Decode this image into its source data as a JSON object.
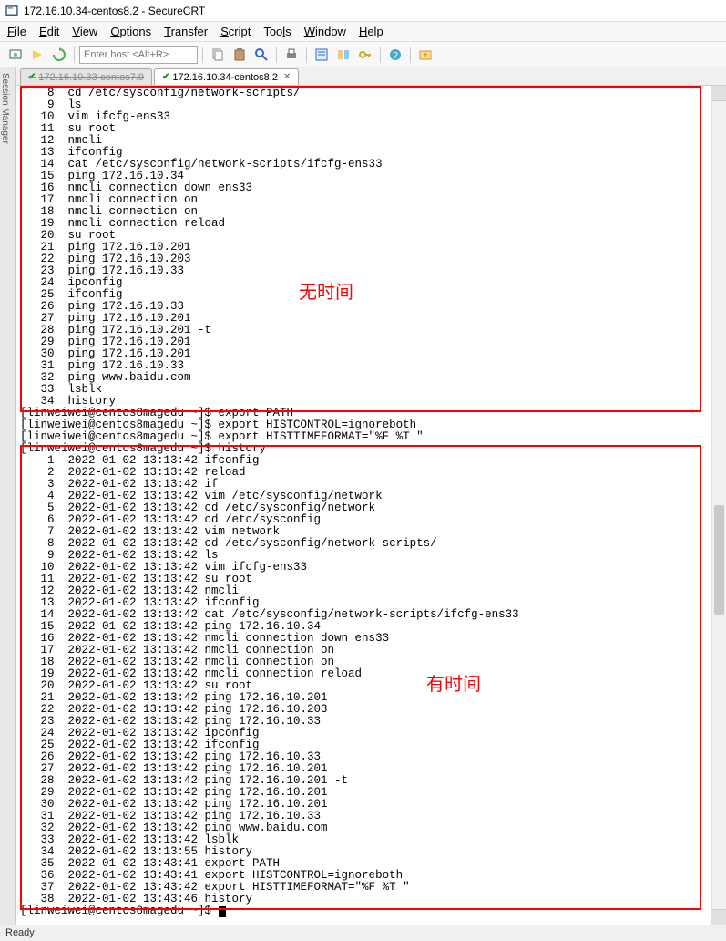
{
  "window": {
    "title": "172.16.10.34-centos8.2 - SecureCRT"
  },
  "menu": {
    "file": "File",
    "edit": "Edit",
    "view": "View",
    "options": "Options",
    "transfer": "Transfer",
    "script": "Script",
    "tools": "Tools",
    "window": "Window",
    "help": "Help"
  },
  "toolbar": {
    "host_placeholder": "Enter host <Alt+R>"
  },
  "session_manager_label": "Session Manager",
  "tabs": [
    {
      "label": "172.16.10.33-centos7.9",
      "active": false
    },
    {
      "label": "172.16.10.34-centos8.2",
      "active": true
    }
  ],
  "annotations": {
    "no_time": "无时间",
    "has_time": "有时间"
  },
  "history_top": [
    {
      "n": "8",
      "cmd": "cd /etc/sysconfig/network-scripts/"
    },
    {
      "n": "9",
      "cmd": "ls"
    },
    {
      "n": "10",
      "cmd": "vim ifcfg-ens33"
    },
    {
      "n": "11",
      "cmd": "su root"
    },
    {
      "n": "12",
      "cmd": "nmcli"
    },
    {
      "n": "13",
      "cmd": "ifconfig"
    },
    {
      "n": "14",
      "cmd": "cat /etc/sysconfig/network-scripts/ifcfg-ens33"
    },
    {
      "n": "15",
      "cmd": "ping 172.16.10.34"
    },
    {
      "n": "16",
      "cmd": "nmcli connection down ens33"
    },
    {
      "n": "17",
      "cmd": "nmcli connection on"
    },
    {
      "n": "18",
      "cmd": "nmcli connection on"
    },
    {
      "n": "19",
      "cmd": "nmcli connection reload"
    },
    {
      "n": "20",
      "cmd": "su root"
    },
    {
      "n": "21",
      "cmd": "ping 172.16.10.201"
    },
    {
      "n": "22",
      "cmd": "ping 172.16.10.203"
    },
    {
      "n": "23",
      "cmd": "ping 172.16.10.33"
    },
    {
      "n": "24",
      "cmd": "ipconfig"
    },
    {
      "n": "25",
      "cmd": "ifconfig"
    },
    {
      "n": "26",
      "cmd": "ping 172.16.10.33"
    },
    {
      "n": "27",
      "cmd": "ping 172.16.10.201"
    },
    {
      "n": "28",
      "cmd": "ping 172.16.10.201 -t"
    },
    {
      "n": "29",
      "cmd": "ping 172.16.10.201"
    },
    {
      "n": "30",
      "cmd": "ping 172.16.10.201"
    },
    {
      "n": "31",
      "cmd": "ping 172.16.10.33"
    },
    {
      "n": "32",
      "cmd": "ping www.baidu.com"
    },
    {
      "n": "33",
      "cmd": "lsblk"
    },
    {
      "n": "34",
      "cmd": "history"
    }
  ],
  "mid_lines": [
    "[linweiwei@centos8magedu ~]$ export PATH",
    "[linweiwei@centos8magedu ~]$ export HISTCONTROL=ignoreboth",
    "[linweiwei@centos8magedu ~]$ export HISTTIMEFORMAT=\"%F %T \"",
    "[linweiwei@centos8magedu ~]$ history"
  ],
  "history_bottom": [
    {
      "n": "1",
      "ts": "2022-01-02 13:13:42",
      "cmd": "ifconfig"
    },
    {
      "n": "2",
      "ts": "2022-01-02 13:13:42",
      "cmd": "reload"
    },
    {
      "n": "3",
      "ts": "2022-01-02 13:13:42",
      "cmd": "if"
    },
    {
      "n": "4",
      "ts": "2022-01-02 13:13:42",
      "cmd": "vim /etc/sysconfig/network"
    },
    {
      "n": "5",
      "ts": "2022-01-02 13:13:42",
      "cmd": "cd /etc/sysconfig/network"
    },
    {
      "n": "6",
      "ts": "2022-01-02 13:13:42",
      "cmd": "cd /etc/sysconfig"
    },
    {
      "n": "7",
      "ts": "2022-01-02 13:13:42",
      "cmd": "vim network"
    },
    {
      "n": "8",
      "ts": "2022-01-02 13:13:42",
      "cmd": "cd /etc/sysconfig/network-scripts/"
    },
    {
      "n": "9",
      "ts": "2022-01-02 13:13:42",
      "cmd": "ls"
    },
    {
      "n": "10",
      "ts": "2022-01-02 13:13:42",
      "cmd": "vim ifcfg-ens33"
    },
    {
      "n": "11",
      "ts": "2022-01-02 13:13:42",
      "cmd": "su root"
    },
    {
      "n": "12",
      "ts": "2022-01-02 13:13:42",
      "cmd": "nmcli"
    },
    {
      "n": "13",
      "ts": "2022-01-02 13:13:42",
      "cmd": "ifconfig"
    },
    {
      "n": "14",
      "ts": "2022-01-02 13:13:42",
      "cmd": "cat /etc/sysconfig/network-scripts/ifcfg-ens33"
    },
    {
      "n": "15",
      "ts": "2022-01-02 13:13:42",
      "cmd": "ping 172.16.10.34"
    },
    {
      "n": "16",
      "ts": "2022-01-02 13:13:42",
      "cmd": "nmcli connection down ens33"
    },
    {
      "n": "17",
      "ts": "2022-01-02 13:13:42",
      "cmd": "nmcli connection on"
    },
    {
      "n": "18",
      "ts": "2022-01-02 13:13:42",
      "cmd": "nmcli connection on"
    },
    {
      "n": "19",
      "ts": "2022-01-02 13:13:42",
      "cmd": "nmcli connection reload"
    },
    {
      "n": "20",
      "ts": "2022-01-02 13:13:42",
      "cmd": "su root"
    },
    {
      "n": "21",
      "ts": "2022-01-02 13:13:42",
      "cmd": "ping 172.16.10.201"
    },
    {
      "n": "22",
      "ts": "2022-01-02 13:13:42",
      "cmd": "ping 172.16.10.203"
    },
    {
      "n": "23",
      "ts": "2022-01-02 13:13:42",
      "cmd": "ping 172.16.10.33"
    },
    {
      "n": "24",
      "ts": "2022-01-02 13:13:42",
      "cmd": "ipconfig"
    },
    {
      "n": "25",
      "ts": "2022-01-02 13:13:42",
      "cmd": "ifconfig"
    },
    {
      "n": "26",
      "ts": "2022-01-02 13:13:42",
      "cmd": "ping 172.16.10.33"
    },
    {
      "n": "27",
      "ts": "2022-01-02 13:13:42",
      "cmd": "ping 172.16.10.201"
    },
    {
      "n": "28",
      "ts": "2022-01-02 13:13:42",
      "cmd": "ping 172.16.10.201 -t"
    },
    {
      "n": "29",
      "ts": "2022-01-02 13:13:42",
      "cmd": "ping 172.16.10.201"
    },
    {
      "n": "30",
      "ts": "2022-01-02 13:13:42",
      "cmd": "ping 172.16.10.201"
    },
    {
      "n": "31",
      "ts": "2022-01-02 13:13:42",
      "cmd": "ping 172.16.10.33"
    },
    {
      "n": "32",
      "ts": "2022-01-02 13:13:42",
      "cmd": "ping www.baidu.com"
    },
    {
      "n": "33",
      "ts": "2022-01-02 13:13:42",
      "cmd": "lsblk"
    },
    {
      "n": "34",
      "ts": "2022-01-02 13:13:55",
      "cmd": "history"
    },
    {
      "n": "35",
      "ts": "2022-01-02 13:43:41",
      "cmd": "export PATH"
    },
    {
      "n": "36",
      "ts": "2022-01-02 13:43:41",
      "cmd": "export HISTCONTROL=ignoreboth"
    },
    {
      "n": "37",
      "ts": "2022-01-02 13:43:42",
      "cmd": "export HISTTIMEFORMAT=\"%F %T \""
    },
    {
      "n": "38",
      "ts": "2022-01-02 13:43:46",
      "cmd": "history"
    }
  ],
  "final_prompt": "[linweiwei@centos8magedu ~]$ ",
  "status": "Ready"
}
